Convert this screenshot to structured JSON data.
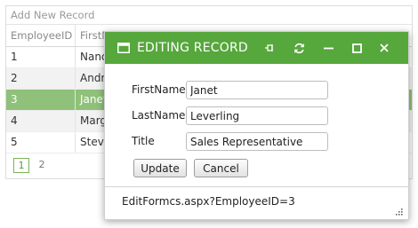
{
  "grid": {
    "toolbar": {
      "add_label": "Add New Record"
    },
    "columns": [
      "EmployeeID",
      "FirstName"
    ],
    "rows": [
      {
        "id": "1",
        "first": "Nancy"
      },
      {
        "id": "2",
        "first": "Andrew"
      },
      {
        "id": "3",
        "first": "Janet"
      },
      {
        "id": "4",
        "first": "Margaret"
      },
      {
        "id": "5",
        "first": "Steven"
      }
    ],
    "selected_row": "3",
    "pager": {
      "pages": [
        "1",
        "2"
      ],
      "current": "1"
    }
  },
  "window": {
    "title": "EDITING RECORD",
    "fields": [
      {
        "label": "FirstName",
        "value": "Janet"
      },
      {
        "label": "LastName",
        "value": "Leverling"
      },
      {
        "label": "Title",
        "value": "Sales Representative"
      }
    ],
    "buttons": {
      "update": "Update",
      "cancel": "Cancel"
    },
    "status": "EditFormcs.aspx?EmployeeID=3"
  },
  "colors": {
    "titlebar": "#56a73c",
    "selected_row": "#8fc17a"
  },
  "icons": [
    "window-icon",
    "pin-icon",
    "reload-icon",
    "minimize-icon",
    "maximize-icon",
    "close-icon",
    "resize-grip-icon"
  ]
}
